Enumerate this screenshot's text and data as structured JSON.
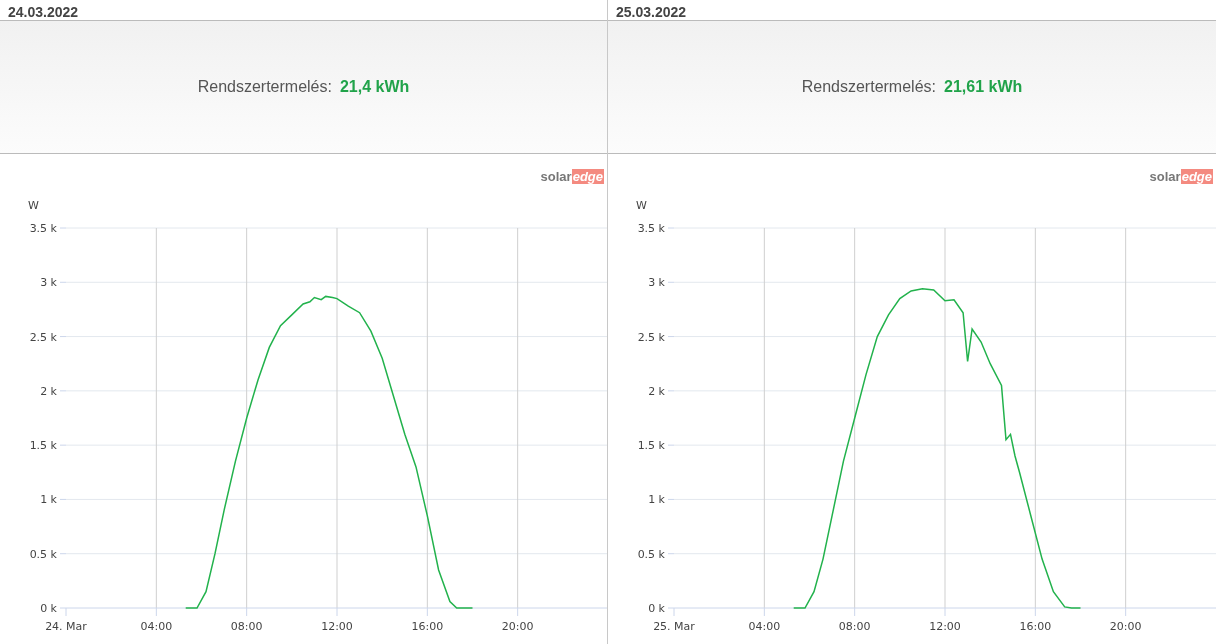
{
  "panels": [
    {
      "date": "24.03.2022",
      "summary_label": "Rendszertermelés:",
      "summary_value": "21,4 kWh",
      "logo": {
        "first": "solar",
        "second": "edge"
      },
      "chart_data": {
        "type": "line",
        "grid": true,
        "ylabel": "W",
        "xlim": [
          0,
          24
        ],
        "ylim": [
          0,
          3500
        ],
        "xticks": [
          {
            "value": 0,
            "label": "24. Mar"
          },
          {
            "value": 4,
            "label": "04:00"
          },
          {
            "value": 8,
            "label": "08:00"
          },
          {
            "value": 12,
            "label": "12:00"
          },
          {
            "value": 16,
            "label": "16:00"
          },
          {
            "value": 20,
            "label": "20:00"
          }
        ],
        "yticks": [
          {
            "value": 0,
            "label": "0 k"
          },
          {
            "value": 500,
            "label": "0.5 k"
          },
          {
            "value": 1000,
            "label": "1 k"
          },
          {
            "value": 1500,
            "label": "1.5 k"
          },
          {
            "value": 2000,
            "label": "2 k"
          },
          {
            "value": 2500,
            "label": "2.5 k"
          },
          {
            "value": 3000,
            "label": "3 k"
          },
          {
            "value": 3500,
            "label": "3.5 k"
          }
        ],
        "x": [
          5.3,
          5.8,
          6.2,
          6.6,
          7.0,
          7.5,
          8,
          8.5,
          9,
          9.5,
          10,
          10.5,
          10.8,
          11,
          11.3,
          11.5,
          11.8,
          12,
          12.5,
          13,
          13.5,
          14,
          14.5,
          15,
          15.5,
          16,
          16.5,
          17,
          17.3,
          18
        ],
        "series": [
          {
            "color": "#22b24c",
            "values": [
              0,
              0,
              150,
              500,
              900,
              1350,
              1750,
              2100,
              2400,
              2600,
              2700,
              2800,
              2820,
              2860,
              2840,
              2870,
              2860,
              2850,
              2780,
              2720,
              2550,
              2300,
              1950,
              1600,
              1300,
              850,
              350,
              60,
              0,
              0
            ]
          }
        ]
      }
    },
    {
      "date": "25.03.2022",
      "summary_label": "Rendszertermelés:",
      "summary_value": "21,61 kWh",
      "logo": {
        "first": "solar",
        "second": "edge"
      },
      "chart_data": {
        "type": "line",
        "grid": true,
        "ylabel": "W",
        "xlim": [
          0,
          24
        ],
        "ylim": [
          0,
          3500
        ],
        "xticks": [
          {
            "value": 0,
            "label": "25. Mar"
          },
          {
            "value": 4,
            "label": "04:00"
          },
          {
            "value": 8,
            "label": "08:00"
          },
          {
            "value": 12,
            "label": "12:00"
          },
          {
            "value": 16,
            "label": "16:00"
          },
          {
            "value": 20,
            "label": "20:00"
          }
        ],
        "yticks": [
          {
            "value": 0,
            "label": "0 k"
          },
          {
            "value": 500,
            "label": "0.5 k"
          },
          {
            "value": 1000,
            "label": "1 k"
          },
          {
            "value": 1500,
            "label": "1.5 k"
          },
          {
            "value": 2000,
            "label": "2 k"
          },
          {
            "value": 2500,
            "label": "2.5 k"
          },
          {
            "value": 3000,
            "label": "3 k"
          },
          {
            "value": 3500,
            "label": "3.5 k"
          }
        ],
        "x": [
          5.3,
          5.8,
          6.2,
          6.6,
          7,
          7.5,
          8,
          8.5,
          9,
          9.5,
          10,
          10.5,
          11,
          11.5,
          12,
          12.4,
          12.8,
          13.0,
          13.2,
          13.6,
          14,
          14.5,
          14.7,
          14.9,
          15.1,
          15.3,
          15.8,
          16.3,
          16.8,
          17.3,
          17.6,
          18
        ],
        "series": [
          {
            "color": "#22b24c",
            "values": [
              0,
              0,
              150,
              450,
              850,
              1350,
              1750,
              2150,
              2500,
              2700,
              2850,
              2920,
              2940,
              2930,
              2830,
              2840,
              2720,
              2270,
              2570,
              2450,
              2250,
              2050,
              1550,
              1600,
              1400,
              1250,
              850,
              450,
              150,
              10,
              0,
              0
            ]
          }
        ]
      }
    }
  ]
}
